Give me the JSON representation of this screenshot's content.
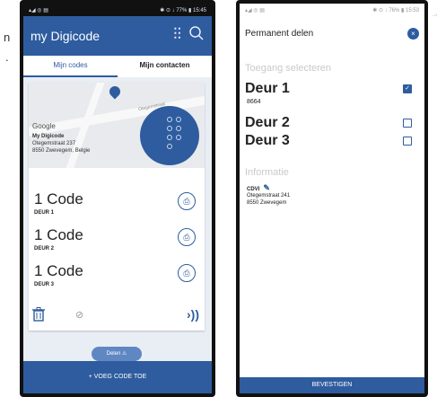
{
  "edge_text": {
    "line1": "n",
    "line2": "."
  },
  "phone1": {
    "status_left": "▴◢ ◎ ▤",
    "status_right": "✱ ⊙ ↓ 77% ▮ 15:45",
    "title": "my Digicode",
    "tabs": [
      {
        "label": "Mijn codes"
      },
      {
        "label": "Mijn contacten"
      }
    ],
    "map": {
      "google": "Google",
      "street": "Otegemstraat"
    },
    "location": {
      "name": "My Digicode",
      "street": "Otegemstraat 237",
      "city": "8550 Zwevegem, Belgie"
    },
    "codes": [
      {
        "label": "1 Code",
        "door": "DEUR 1"
      },
      {
        "label": "1 Code",
        "door": "DEUR 2"
      },
      {
        "label": "1 Code",
        "door": "DEUR 3"
      }
    ],
    "delen_label": "Delen ⚠",
    "bottom_label": "+ VOEG CODE TOE"
  },
  "phone2": {
    "status_left": "▴◢ ◎ ▤",
    "status_right": "✱ ⊙ ↓ 76% ▮ 15:53",
    "header_title": "Permanent delen",
    "close_symbol": "×",
    "section_select": "Toegang selecteren",
    "doors": [
      {
        "name": "Deur 1",
        "code": "8664",
        "checked": true
      },
      {
        "name": "Deur 2",
        "checked": false
      },
      {
        "name": "Deur 3",
        "checked": false
      }
    ],
    "section_info": "Informatie",
    "info": {
      "name": "CDVI",
      "street": "Otegemstraat 241",
      "city": "8550 Zwevegem"
    },
    "confirm_label": "BEVESTIGEN"
  },
  "colors": {
    "brand_blue": "#2e5c9f",
    "background": "#e9eef5"
  },
  "icons": [
    "settings-sliders-icon",
    "search-icon",
    "map-pin-icon",
    "keypad-icon",
    "share-code-icon",
    "trash-icon",
    "link-icon",
    "sound-icon",
    "close-icon",
    "checkbox-checked-icon",
    "checkbox-empty-icon",
    "pencil-icon"
  ]
}
